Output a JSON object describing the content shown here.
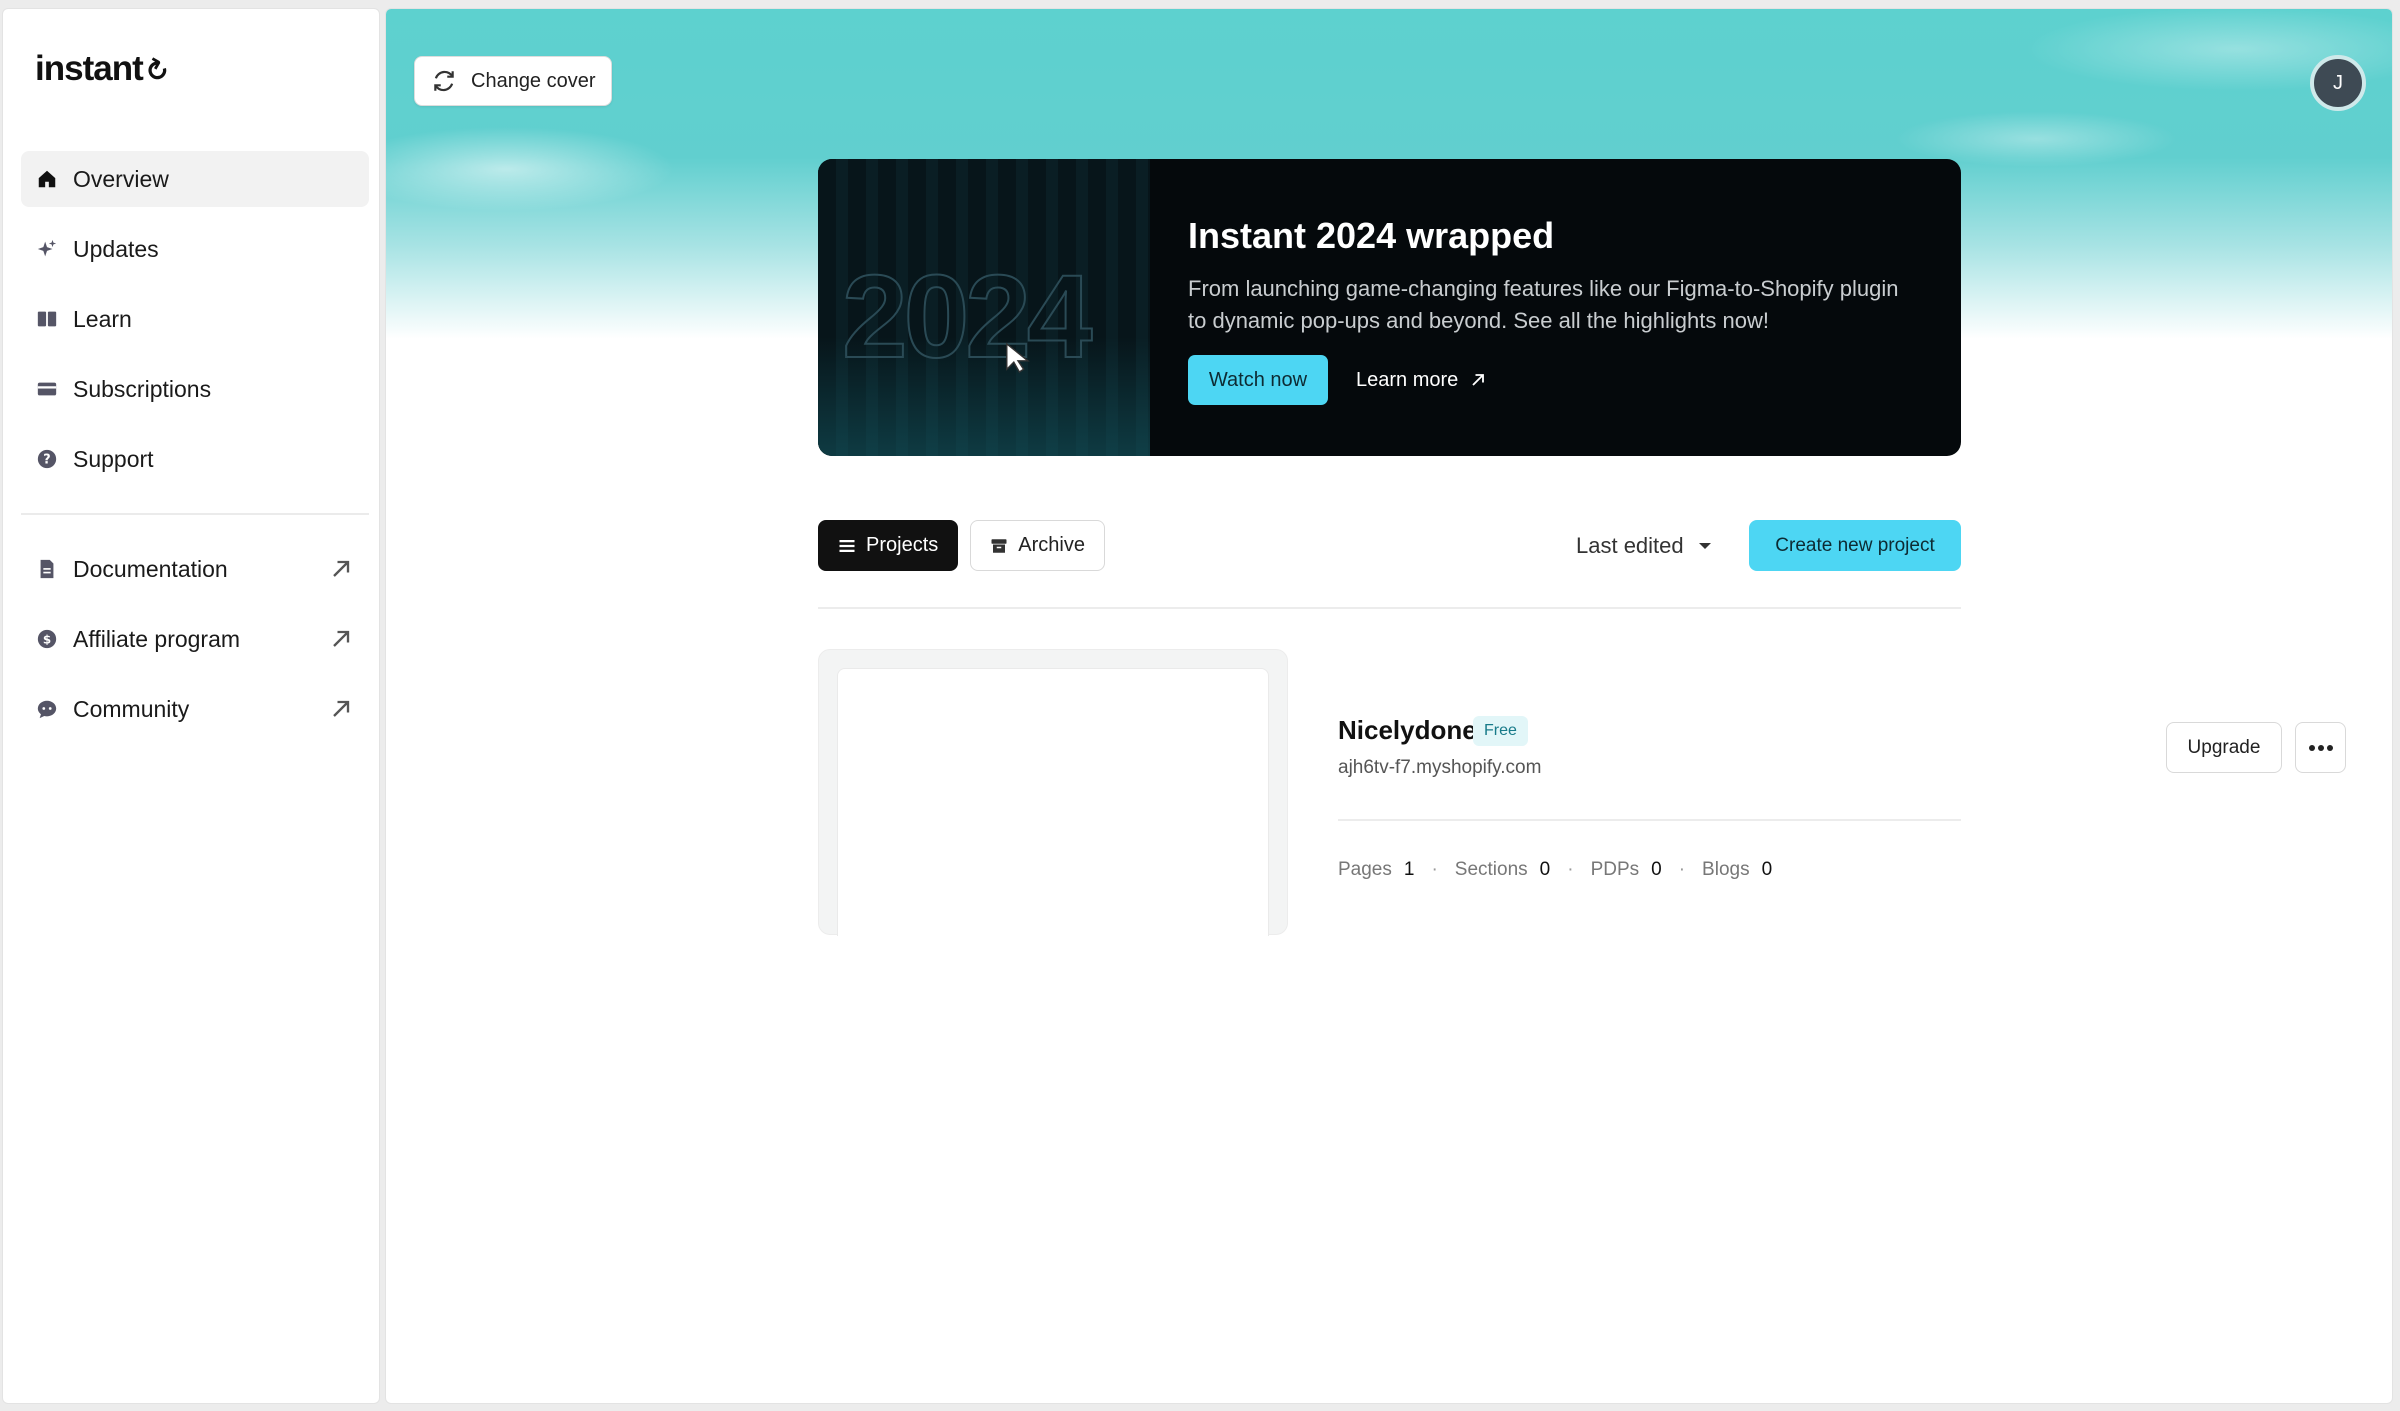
{
  "sidebar": {
    "logo": "instant",
    "items": [
      {
        "label": "Overview",
        "icon": "home-icon"
      },
      {
        "label": "Updates",
        "icon": "sparkle-icon"
      },
      {
        "label": "Learn",
        "icon": "book-icon"
      },
      {
        "label": "Subscriptions",
        "icon": "card-icon"
      },
      {
        "label": "Support",
        "icon": "help-icon"
      }
    ],
    "external": [
      {
        "label": "Documentation",
        "icon": "document-icon"
      },
      {
        "label": "Affiliate program",
        "icon": "dollar-icon"
      },
      {
        "label": "Community",
        "icon": "chat-icon"
      }
    ]
  },
  "header": {
    "change_cover": "Change cover",
    "avatar_initial": "J"
  },
  "banner": {
    "art_year": "2024",
    "title": "Instant 2024 wrapped",
    "description": "From launching game-changing features like our Figma-to-Shopify plugin to dynamic pop-ups and beyond. See all the highlights now!",
    "watch_label": "Watch now",
    "learn_label": "Learn more"
  },
  "toolbar": {
    "tabs": [
      "Projects",
      "Archive"
    ],
    "sort_label": "Last edited",
    "create_label": "Create new project"
  },
  "project": {
    "name": "Nicelydone",
    "plan": "Free",
    "domain": "ajh6tv-f7.myshopify.com",
    "upgrade_label": "Upgrade",
    "stats": [
      {
        "label": "Pages",
        "value": "1"
      },
      {
        "label": "Sections",
        "value": "0"
      },
      {
        "label": "PDPs",
        "value": "0"
      },
      {
        "label": "Blogs",
        "value": "0"
      }
    ]
  },
  "colors": {
    "accent": "#4dd6f3",
    "cover": "#5dd1cf",
    "banner_bg": "#05090c"
  }
}
